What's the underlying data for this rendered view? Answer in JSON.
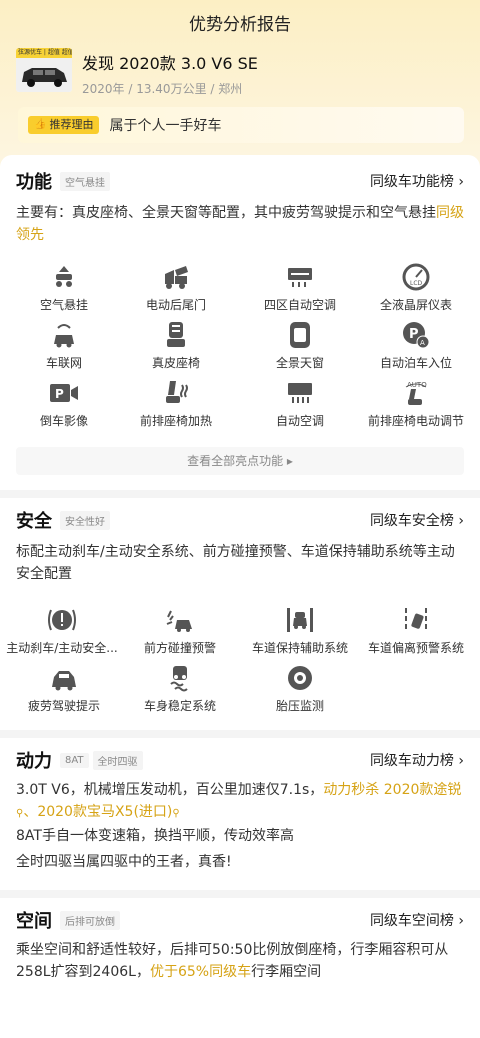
{
  "header": {
    "title": "优势分析报告"
  },
  "car": {
    "thumb_banner": "弦源优车 | 超值 超值延保",
    "name": "发现 2020款 3.0 V6 SE",
    "meta": "2020年 / 13.40万公里 / 郑州"
  },
  "reason": {
    "tag": "推荐理由",
    "text": "属于个人一手好车"
  },
  "function": {
    "title": "功能",
    "tag": "空气悬挂",
    "link": "同级车功能榜 ›",
    "desc_main": "主要有：真皮座椅、全景天窗等配置，其中疲劳驾驶提示和空气悬挂",
    "desc_highlight": "同级领先",
    "items": [
      {
        "label": "空气悬挂",
        "icon": "air-suspension-icon"
      },
      {
        "label": "电动后尾门",
        "icon": "power-tailgate-icon"
      },
      {
        "label": "四区自动空调",
        "icon": "four-zone-ac-icon"
      },
      {
        "label": "全液晶屏仪表",
        "icon": "lcd-dashboard-icon"
      },
      {
        "label": "车联网",
        "icon": "connected-car-icon"
      },
      {
        "label": "真皮座椅",
        "icon": "leather-seat-icon"
      },
      {
        "label": "全景天窗",
        "icon": "panoramic-sunroof-icon"
      },
      {
        "label": "自动泊车入位",
        "icon": "auto-parking-icon"
      },
      {
        "label": "倒车影像",
        "icon": "reverse-camera-icon"
      },
      {
        "label": "前排座椅加热",
        "icon": "seat-heating-icon"
      },
      {
        "label": "自动空调",
        "icon": "auto-ac-icon"
      },
      {
        "label": "前排座椅电动调节",
        "icon": "power-seat-icon"
      }
    ],
    "more": "查看全部亮点功能 ▸"
  },
  "safety": {
    "title": "安全",
    "tag": "安全性好",
    "link": "同级车安全榜 ›",
    "desc": "标配主动刹车/主动安全系统、前方碰撞预警、车道保持辅助系统等主动安全配置",
    "items": [
      {
        "label": "主动刹车/主动安全...",
        "icon": "active-brake-icon"
      },
      {
        "label": "前方碰撞预警",
        "icon": "collision-warning-icon"
      },
      {
        "label": "车道保持辅助系统",
        "icon": "lane-keep-icon"
      },
      {
        "label": "车道偏离预警系统",
        "icon": "lane-departure-icon"
      },
      {
        "label": "疲劳驾驶提示",
        "icon": "fatigue-alert-icon"
      },
      {
        "label": "车身稳定系统",
        "icon": "stability-icon"
      },
      {
        "label": "胎压监测",
        "icon": "tire-pressure-icon"
      }
    ]
  },
  "power": {
    "title": "动力",
    "tags": [
      "8AT",
      "全时四驱"
    ],
    "link": "同级车动力榜 ›",
    "line1_a": "3.0T V6，机械增压发动机，百公里加速仅7.1s，",
    "line1_hl1": "动力秒杀 2020款途锐",
    "line1_sep": "、",
    "line1_hl2": "2020款宝马X5(进口)",
    "line2": "8AT手自一体变速箱，换挡平顺，传动效率高",
    "line3": "全时四驱当属四驱中的王者，真香!"
  },
  "space": {
    "title": "空间",
    "tag": "后排可放倒",
    "link": "同级车空间榜 ›",
    "desc_a": "乘坐空间和舒适性较好，后排可50:50比例放倒座椅，行李厢容积可从258L扩容到2406L，",
    "desc_hl": "优于65%同级车",
    "desc_b": "行李厢空间"
  },
  "colors": {
    "accent": "#f9cd2d",
    "highlight": "#d6a316"
  }
}
